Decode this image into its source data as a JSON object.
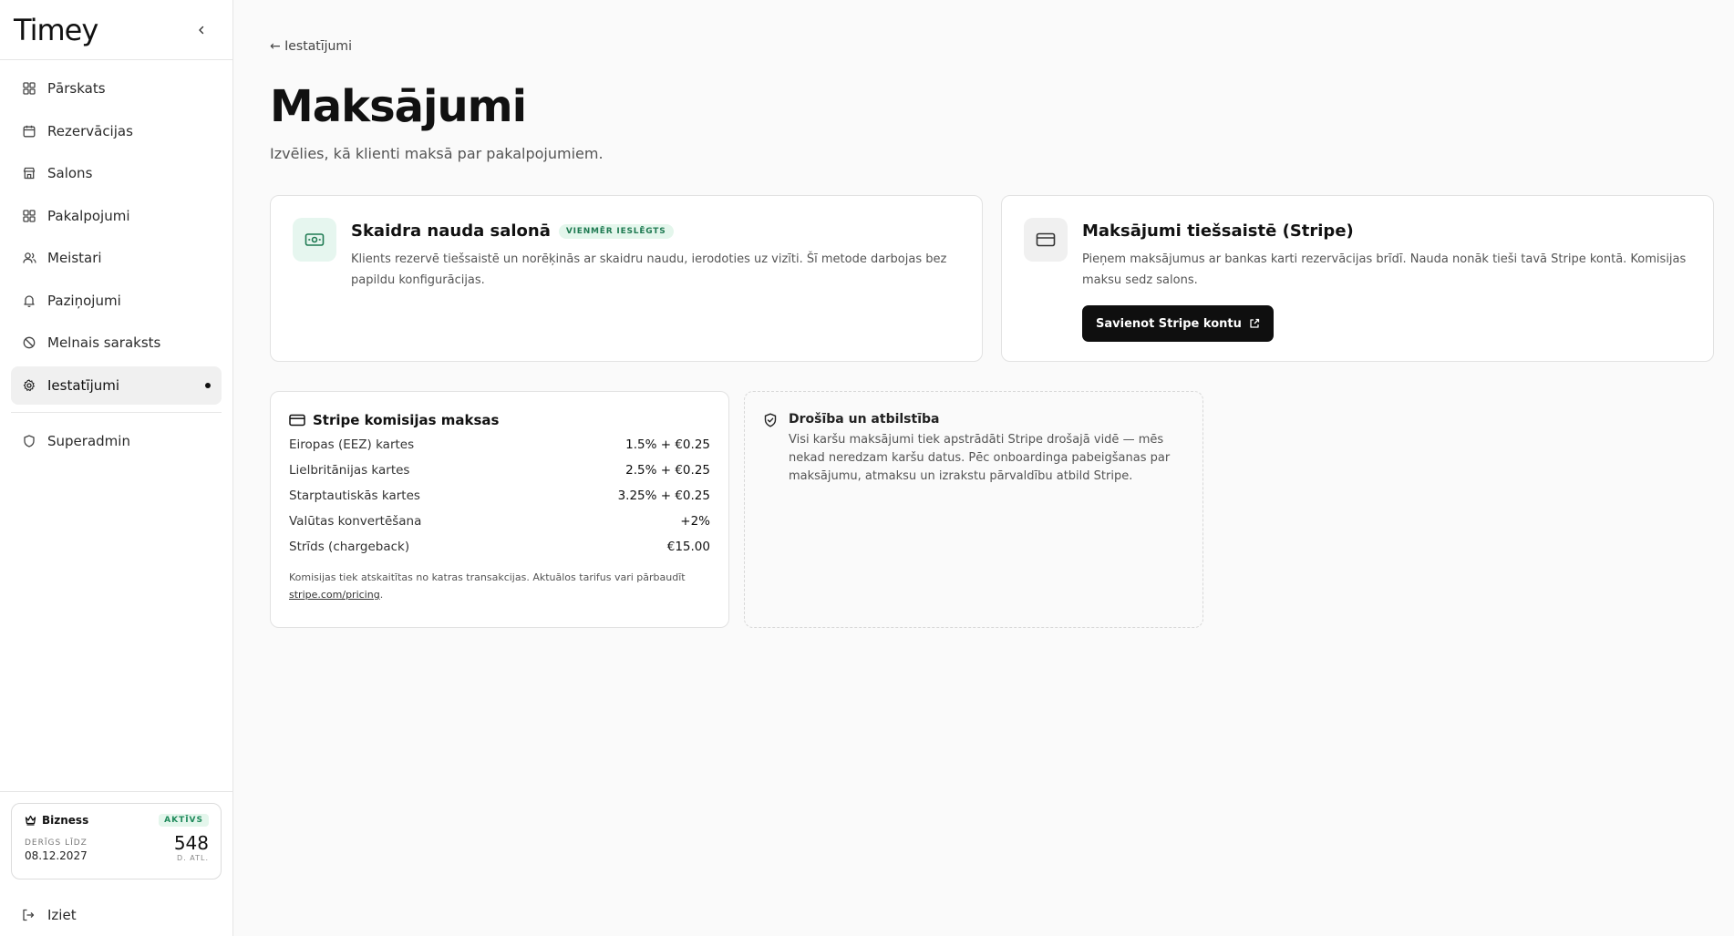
{
  "app": {
    "logo": "Timey"
  },
  "sidebar": {
    "items": [
      {
        "label": "Pārskats",
        "icon": "grid-icon"
      },
      {
        "label": "Rezervācijas",
        "icon": "calendar-icon"
      },
      {
        "label": "Salons",
        "icon": "store-icon"
      },
      {
        "label": "Pakalpojumi",
        "icon": "grid-icon"
      },
      {
        "label": "Meistari",
        "icon": "users-icon"
      },
      {
        "label": "Paziņojumi",
        "icon": "bell-icon"
      },
      {
        "label": "Melnais saraksts",
        "icon": "ban-icon"
      },
      {
        "label": "Iestatījumi",
        "icon": "gear-icon",
        "active": true
      }
    ],
    "admin": {
      "label": "Superadmin",
      "icon": "shield-icon"
    },
    "plan": {
      "name": "Bizness",
      "status": "AKTĪVS",
      "valid_label": "DERĪGS LĪDZ",
      "valid_date": "08.12.2027",
      "days": "548",
      "days_label": "D. ATL."
    },
    "logout": "Iziet"
  },
  "main": {
    "back": "← Iestatījumi",
    "title": "Maksājumi",
    "subtitle": "Izvēlies, kā klienti maksā par pakalpojumiem.",
    "cash": {
      "title": "Skaidra nauda salonā",
      "badge": "VIENMĒR IESLĒGTS",
      "desc": "Klients rezervē tiešsaistē un norēķinās ar skaidru naudu, ierodoties uz vizīti. Šī metode darbojas bez papildu konfigurācijas."
    },
    "stripe": {
      "title": "Maksājumi tiešsaistē (Stripe)",
      "desc": "Pieņem maksājumus ar bankas karti rezervācijas brīdī. Nauda nonāk tieši tavā Stripe kontā. Komisijas maksu sedz salons.",
      "button": "Savienot Stripe kontu"
    },
    "fees": {
      "title": "Stripe komisijas maksas",
      "rows": [
        {
          "label": "Eiropas (EEZ) kartes",
          "value": "1.5% + €0.25"
        },
        {
          "label": "Lielbritānijas kartes",
          "value": "2.5% + €0.25"
        },
        {
          "label": "Starptautiskās kartes",
          "value": "3.25% + €0.25"
        },
        {
          "label": "Valūtas konvertēšana",
          "value": "+2%"
        },
        {
          "label": "Strīds (chargeback)",
          "value": "€15.00"
        }
      ],
      "note": "Komisijas tiek atskaitītas no katras transakcijas. Aktuālos tarifus vari pārbaudīt",
      "note_link": "stripe.com/pricing",
      "note_end": "."
    },
    "security": {
      "title": "Drošība un atbilstība",
      "text": "Visi karšu maksājumi tiek apstrādāti Stripe drošajā vidē — mēs nekad neredzam karšu datus. Pēc onboardinga pabeigšanas par maksājumu, atmaksu un izrakstu pārvaldību atbild Stripe."
    }
  }
}
